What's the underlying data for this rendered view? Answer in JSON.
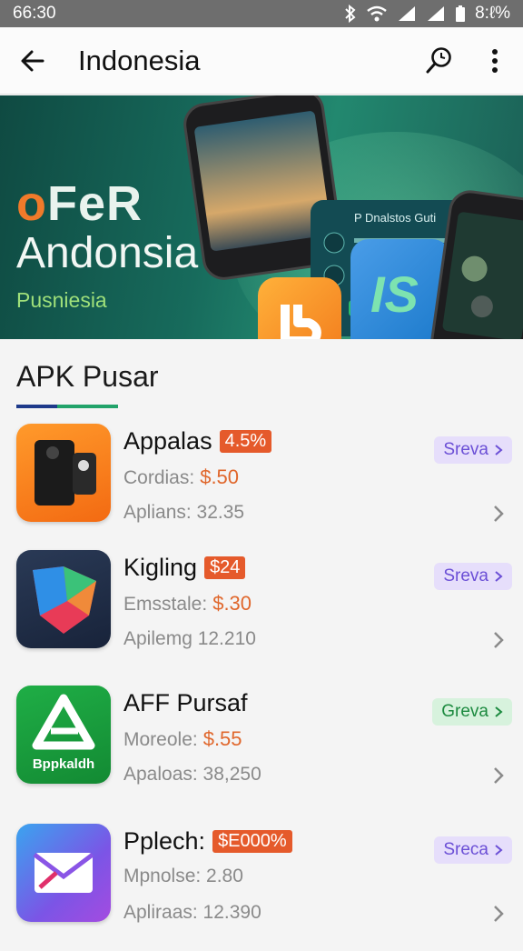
{
  "status_bar": {
    "time": "66:30",
    "battery": "8:ℓ%"
  },
  "app_bar": {
    "title": "Indonesia"
  },
  "banner": {
    "offer_o": "o",
    "offer_rest": "FeR",
    "title": "Andonsia",
    "subtitle": "Pusniesia",
    "panel_title": "P Dnalstos Guti",
    "tile_text": "IS"
  },
  "section": {
    "title": "APK Pusar"
  },
  "items": [
    {
      "name": "Appalas",
      "badge": "4.5%",
      "line2_label": "Cordias:",
      "price": "$.50",
      "line3": "Aplians: 32.35",
      "action": "Sreva",
      "action_style": "purple",
      "icon": "phone-case-icon"
    },
    {
      "name": "Kigling",
      "badge": "$24",
      "line2_label": "Emsstale:",
      "price": "$.30",
      "line3": "Apilemg 12.210",
      "action": "Sreva",
      "action_style": "purple",
      "icon": "shield-logo-icon"
    },
    {
      "name": "AFF Pursaf",
      "badge": "",
      "line2_label": "Moreole:",
      "price": "$.55",
      "line3": "Apaloas: 38,250",
      "action": "Greva",
      "action_style": "green",
      "icon": "triangle-logo-icon",
      "icon_caption": "Bppkaldh"
    },
    {
      "name": "Pplech:",
      "badge": "$E000%",
      "line2_label": "Mpnolse: 2.80",
      "price": "",
      "line3": "Apliraas: 12.390",
      "action": "Sreca",
      "action_style": "purple",
      "icon": "mail-envelope-icon"
    }
  ],
  "colors": {
    "accent_orange": "#e55a2b",
    "action_purple": "#6b4fd6",
    "action_green": "#1c8a3f",
    "banner_teal": "#176b5c"
  }
}
